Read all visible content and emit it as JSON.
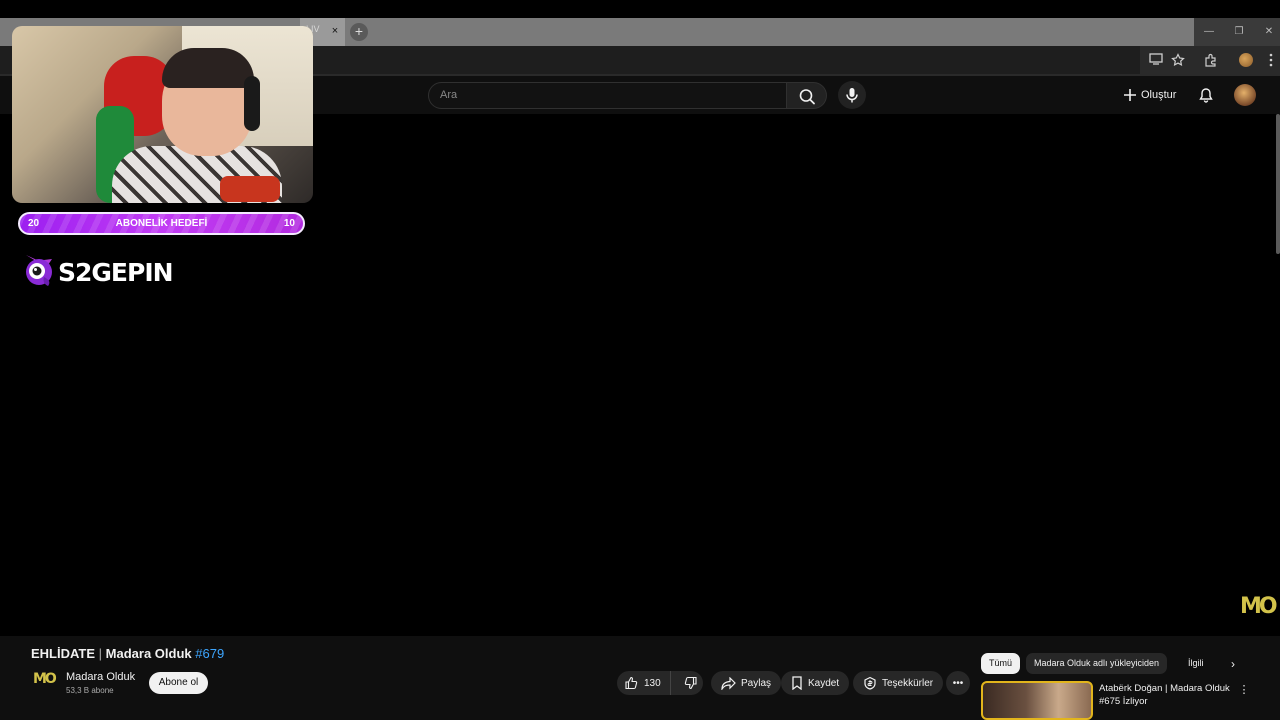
{
  "browser": {
    "tab_title": "LIV",
    "tab_close": "×",
    "new_tab": "+",
    "window_controls": {
      "minimize": "—",
      "restore": "❐",
      "close": "✕"
    }
  },
  "youtube": {
    "search_placeholder": "Ara",
    "create_label": "Oluştur"
  },
  "overlay": {
    "goal": {
      "left_value": "20",
      "label": "ABONELİK HEDEFİ",
      "right_value": "10"
    },
    "brand": "S2GEPIN",
    "watermark": "MO"
  },
  "video": {
    "title_main": "EHLİDATE",
    "title_sep": " | ",
    "title_channel": "Madara Olduk",
    "title_tag": "#679",
    "channel_logo": "MO",
    "channel_name": "Madara Olduk",
    "subscribers": "53,3 B abone",
    "subscribe_label": "Abone ol",
    "likes": "130",
    "share_label": "Paylaş",
    "save_label": "Kaydet",
    "thanks_label": "Teşekkürler",
    "more_label": "•••"
  },
  "chips": {
    "all": "Tümü",
    "uploader": "Madara Olduk adlı yükleyiciden",
    "related": "İlgili",
    "next": "›"
  },
  "recommendation": {
    "title": "Atabërk Doğan | Madara Olduk #675 İzliyor",
    "menu": "⋮"
  },
  "colors": {
    "goal_bar": "#b22ae0",
    "title_tag": "#3ea6ff",
    "watermark": "#d2c24a",
    "rec_border": "#e2b51c"
  }
}
